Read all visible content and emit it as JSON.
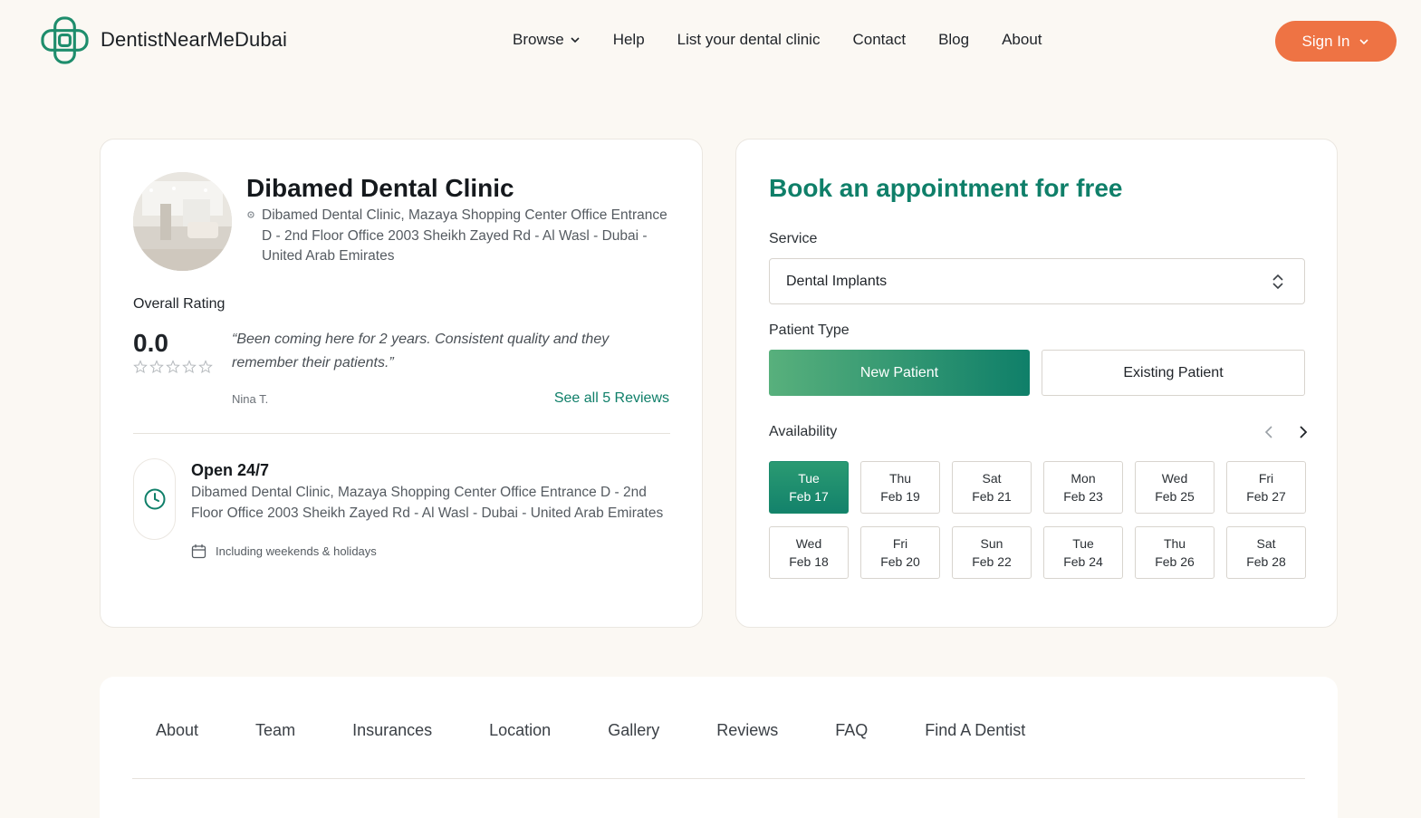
{
  "header": {
    "brand": "DentistNearMeDubai",
    "nav": [
      {
        "label": "Browse",
        "has_dropdown": true
      },
      {
        "label": "Help"
      },
      {
        "label": "List your dental clinic"
      },
      {
        "label": "Contact"
      },
      {
        "label": "Blog"
      },
      {
        "label": "About"
      }
    ],
    "signin_label": "Sign In"
  },
  "clinic": {
    "name": "Dibamed Dental Clinic",
    "address": "Dibamed Dental Clinic, Mazaya Shopping Center Office Entrance D - 2nd Floor Office 2003 Sheikh Zayed Rd - Al Wasl - Dubai - United Arab Emirates",
    "rating_label": "Overall Rating",
    "rating_value": "0.0",
    "stars_filled": 0,
    "stars_total": 5,
    "quote": "“Been coming here for 2 years. Consistent quality and they remember their patients.”",
    "reviewer": "Nina T.",
    "see_all": "See all 5 Reviews",
    "hours_title": "Open 24/7",
    "hours_address": "Dibamed Dental Clinic, Mazaya Shopping Center Office Entrance D - 2nd Floor Office 2003 Sheikh Zayed Rd - Al Wasl - Dubai - United Arab Emirates",
    "hours_note": "Including weekends & holidays"
  },
  "booking": {
    "title": "Book an appointment for free",
    "service_label": "Service",
    "service_value": "Dental Implants",
    "patient_type_label": "Patient Type",
    "patient_types": [
      "New Patient",
      "Existing Patient"
    ],
    "availability_label": "Availability",
    "dates": [
      {
        "day": "Tue",
        "date": "Feb 17",
        "selected": true
      },
      {
        "day": "Thu",
        "date": "Feb 19"
      },
      {
        "day": "Sat",
        "date": "Feb 21"
      },
      {
        "day": "Mon",
        "date": "Feb 23"
      },
      {
        "day": "Wed",
        "date": "Feb 25"
      },
      {
        "day": "Fri",
        "date": "Feb 27"
      },
      {
        "day": "Wed",
        "date": "Feb 18"
      },
      {
        "day": "Fri",
        "date": "Feb 20"
      },
      {
        "day": "Sun",
        "date": "Feb 22"
      },
      {
        "day": "Tue",
        "date": "Feb 24"
      },
      {
        "day": "Thu",
        "date": "Feb 26"
      },
      {
        "day": "Sat",
        "date": "Feb 28"
      }
    ]
  },
  "tabs": [
    "About",
    "Team",
    "Insurances",
    "Location",
    "Gallery",
    "Reviews",
    "FAQ",
    "Find A Dentist"
  ],
  "colors": {
    "accent": "#0f7f69",
    "signin": "#ee7344",
    "background": "#fbf8f3"
  }
}
